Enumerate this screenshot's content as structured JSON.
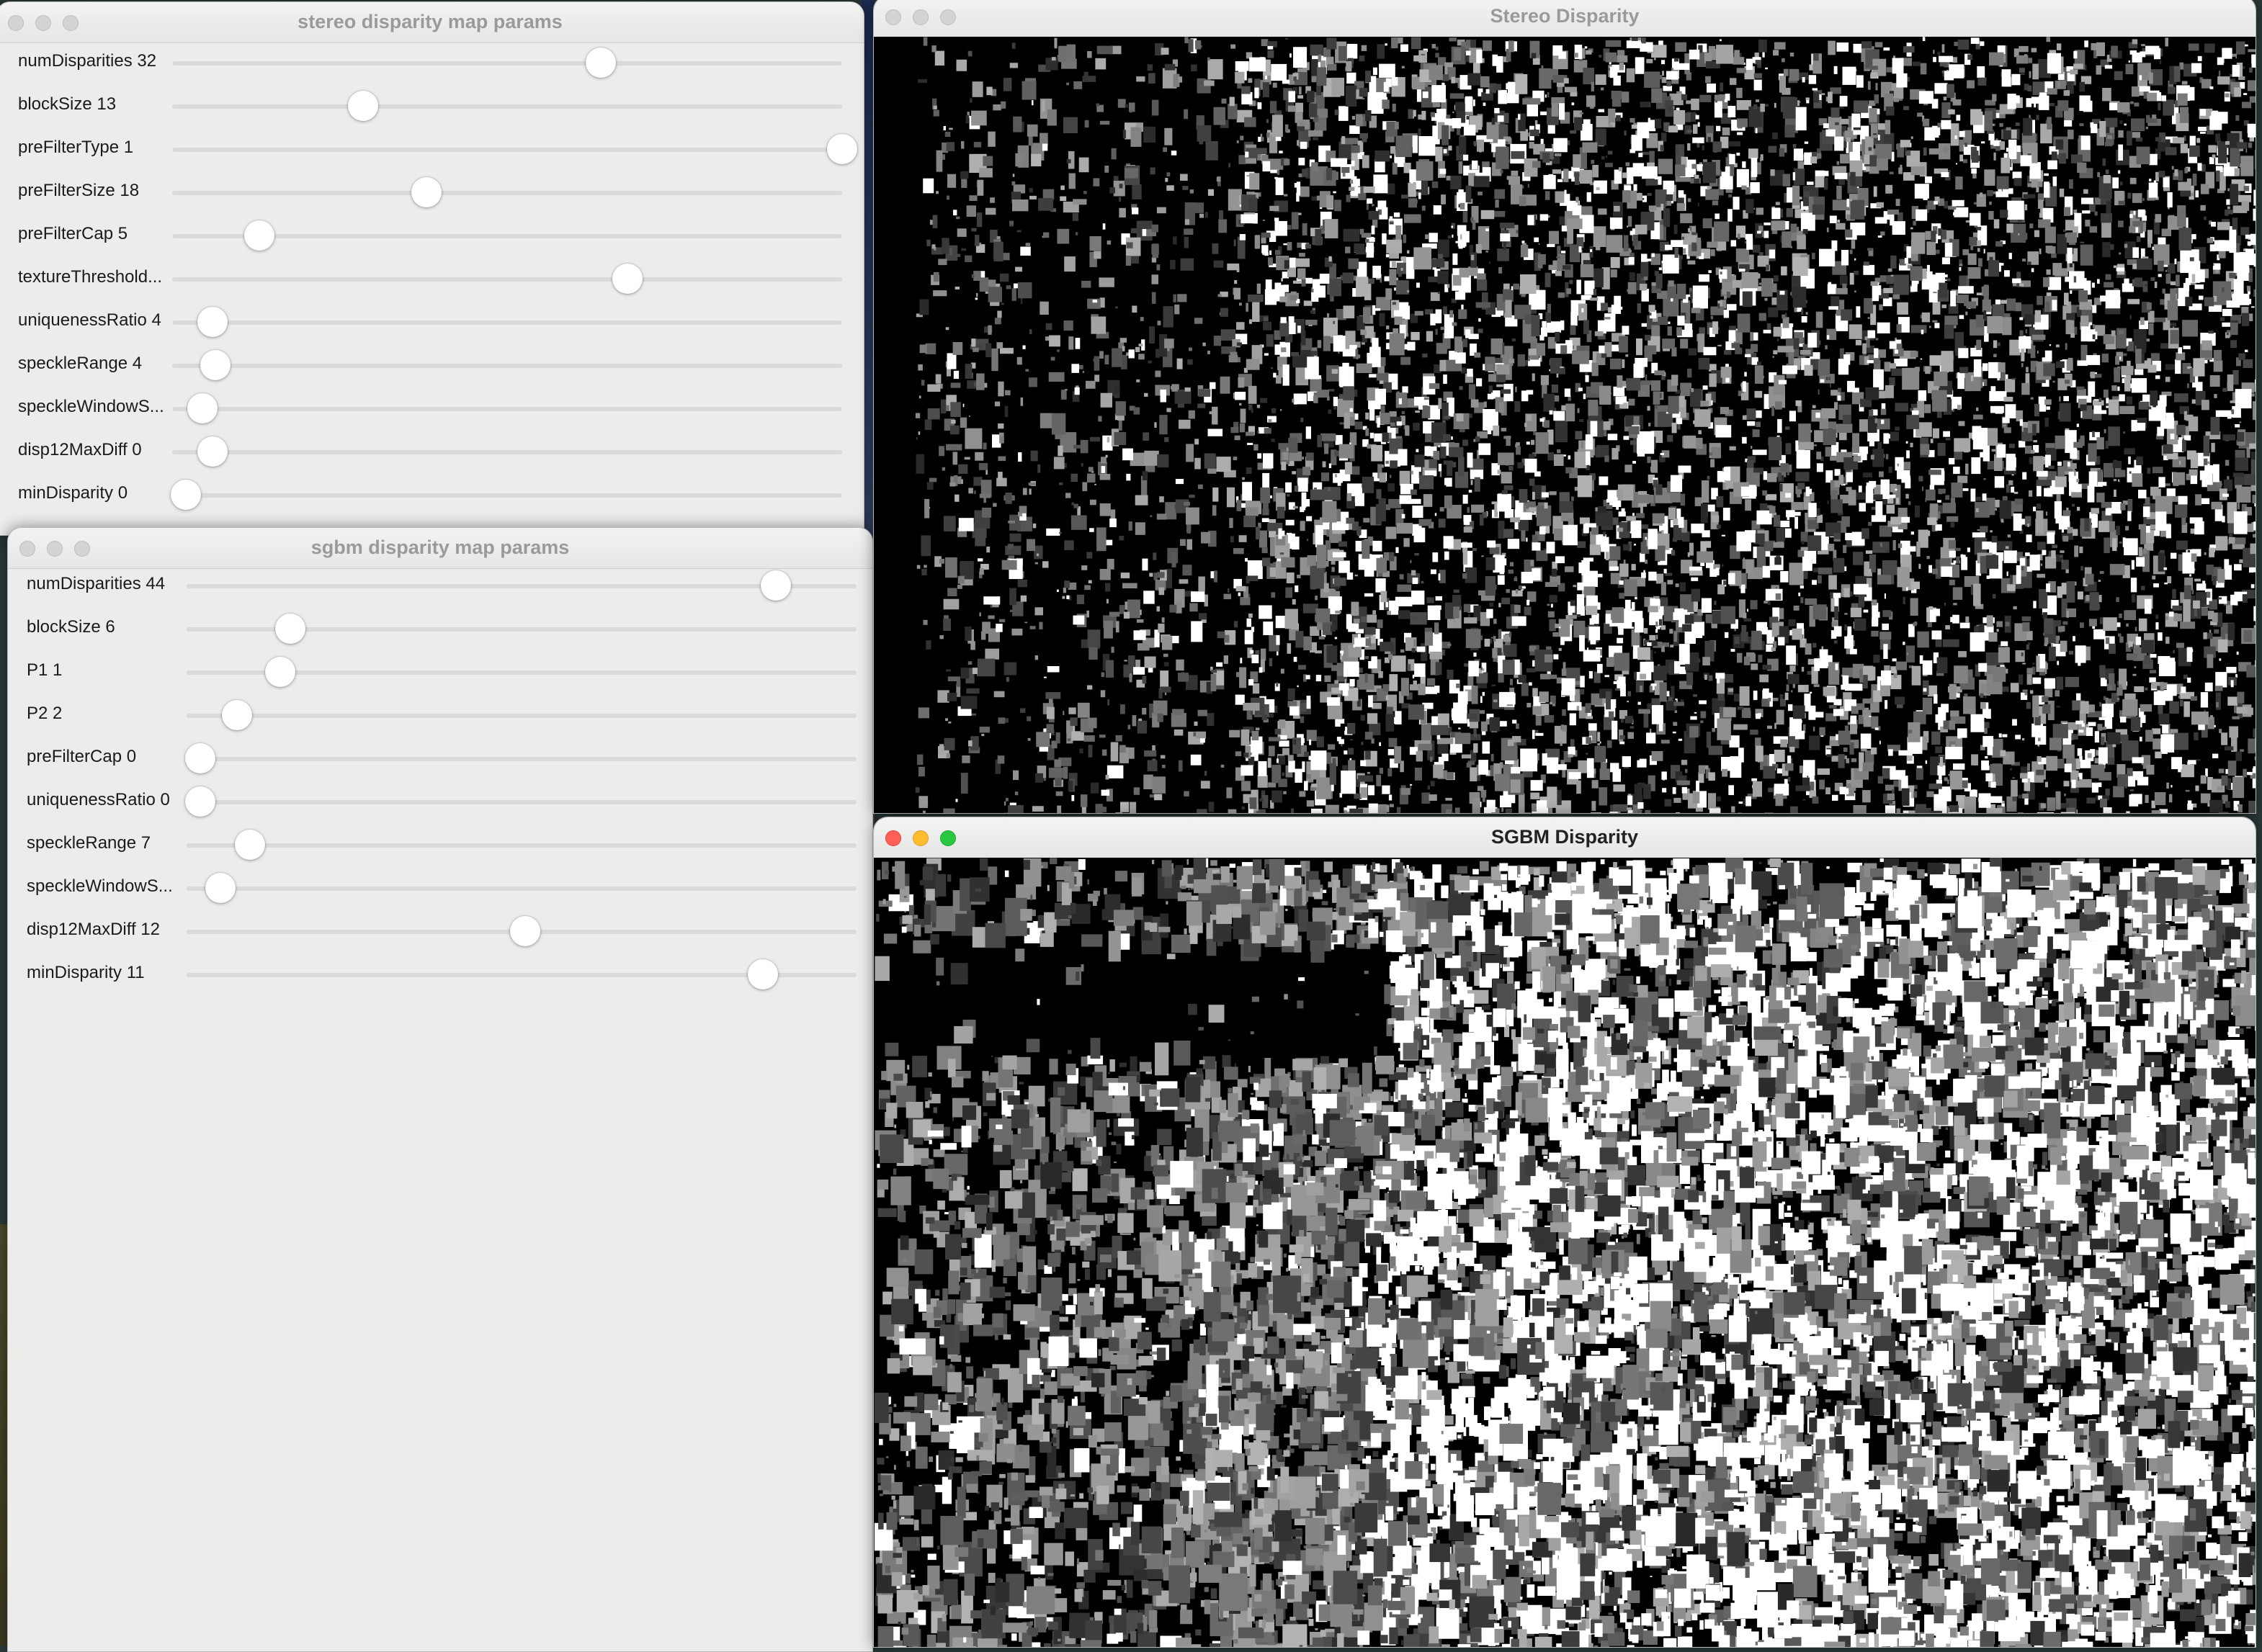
{
  "stereo_params": {
    "title": "stereo disparity map params",
    "sliders": [
      {
        "label": "numDisparities 32",
        "fraction": 0.64
      },
      {
        "label": "blockSize 13",
        "fraction": 0.285
      },
      {
        "label": "preFilterType 1",
        "fraction": 1.0
      },
      {
        "label": "preFilterSize 18",
        "fraction": 0.38
      },
      {
        "label": "preFilterCap 5",
        "fraction": 0.13
      },
      {
        "label": "textureThreshold...",
        "fraction": 0.68
      },
      {
        "label": "uniquenessRatio 4",
        "fraction": 0.06
      },
      {
        "label": "speckleRange 4",
        "fraction": 0.065
      },
      {
        "label": "speckleWindowS...",
        "fraction": 0.045
      },
      {
        "label": "disp12MaxDiff 0",
        "fraction": 0.06
      },
      {
        "label": "minDisparity 0",
        "fraction": 0.02
      }
    ]
  },
  "sgbm_params": {
    "title": "sgbm disparity map params",
    "sliders": [
      {
        "label": "numDisparities 44",
        "fraction": 0.88
      },
      {
        "label": "blockSize 6",
        "fraction": 0.155
      },
      {
        "label": "P1 1",
        "fraction": 0.14
      },
      {
        "label": "P2 2",
        "fraction": 0.075
      },
      {
        "label": "preFilterCap 0",
        "fraction": 0.02
      },
      {
        "label": "uniquenessRatio 0",
        "fraction": 0.02
      },
      {
        "label": "speckleRange 7",
        "fraction": 0.095
      },
      {
        "label": "speckleWindowS...",
        "fraction": 0.05
      },
      {
        "label": "disp12MaxDiff 12",
        "fraction": 0.505
      },
      {
        "label": "minDisparity 11",
        "fraction": 0.86
      }
    ]
  },
  "stereo_window": {
    "title": "Stereo Disparity"
  },
  "sgbm_window": {
    "title": "SGBM Disparity"
  },
  "colors": {
    "window_bg": "#ececeb",
    "track": "#dadada",
    "thumb": "#ffffff"
  },
  "icons": [
    "close-icon",
    "minimize-icon",
    "zoom-icon"
  ]
}
